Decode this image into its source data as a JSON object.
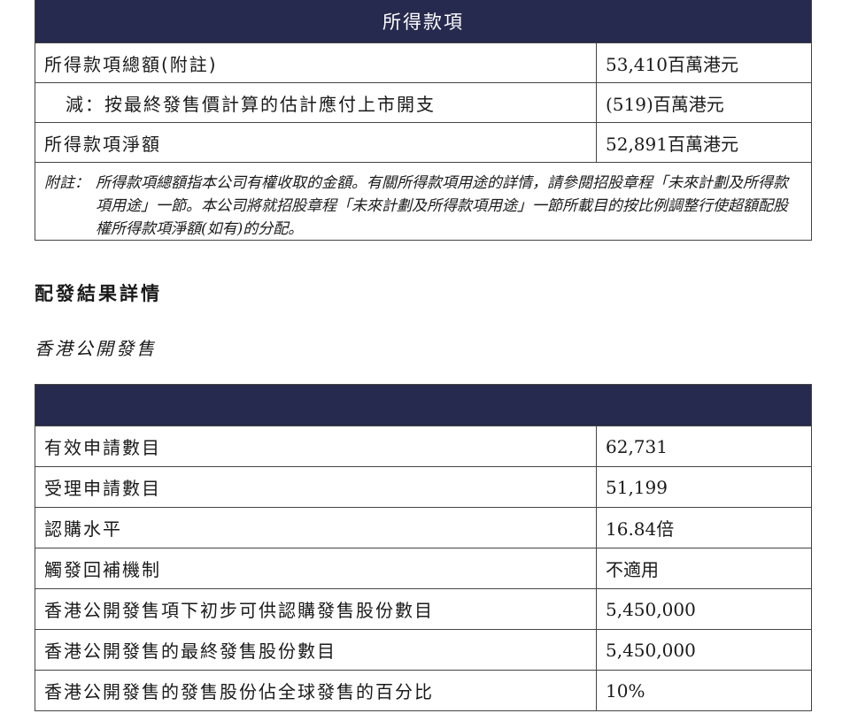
{
  "proceeds_table": {
    "header": "所得款項",
    "rows": [
      {
        "label": "所得款項總額(附註)",
        "value": "53,410百萬港元"
      },
      {
        "label": "減：按最終發售價計算的估計應付上市開支",
        "value": "(519)百萬港元"
      },
      {
        "label": "所得款項淨額",
        "value": "52,891百萬港元"
      }
    ],
    "note_label": "附註：",
    "note_text": "所得款項總額指本公司有權收取的金額。有關所得款項用途的詳情，請參閱招股章程「未來計劃及所得款項用途」一節。本公司將就招股章程「未來計劃及所得款項用途」一節所載目的按比例調整行使超額配股權所得款項淨額(如有)的分配。"
  },
  "section_heading": "配發結果詳情",
  "section_subheading": "香港公開發售",
  "offering_table": {
    "rows": [
      {
        "label": "有效申請數目",
        "value": "62,731"
      },
      {
        "label": "受理申請數目",
        "value": "51,199"
      },
      {
        "label": "認購水平",
        "value": "16.84倍"
      },
      {
        "label": "觸發回補機制",
        "value": "不適用"
      },
      {
        "label": "香港公開發售項下初步可供認購發售股份數目",
        "value": "5,450,000"
      },
      {
        "label": "香港公開發售的最終發售股份數目",
        "value": "5,450,000"
      },
      {
        "label": "香港公開發售的發售股份佔全球發售的百分比",
        "value": "10%"
      }
    ]
  },
  "colors": {
    "header_bg": "#262a4e",
    "border": "#444444"
  }
}
